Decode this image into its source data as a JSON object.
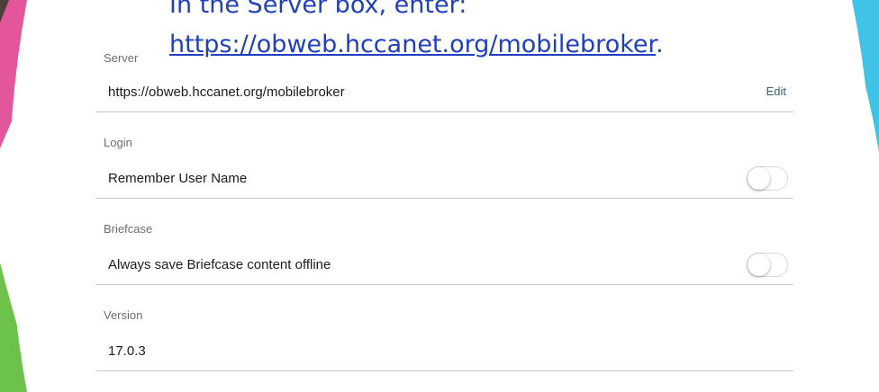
{
  "caption": {
    "line1": "In the Server box, enter:",
    "link": "https://obweb.hccanet.org/mobilebroker",
    "link_suffix": "."
  },
  "server": {
    "label": "Server",
    "value": "https://obweb.hccanet.org/mobilebroker",
    "edit_label": "Edit"
  },
  "login": {
    "label": "Login",
    "remember_label": "Remember User Name",
    "remember_on": false
  },
  "briefcase": {
    "label": "Briefcase",
    "offline_label": "Always save Briefcase content offline",
    "offline_on": false
  },
  "version": {
    "label": "Version",
    "value": "17.0.3"
  },
  "colors": {
    "caption_blue": "#1f3fbf",
    "accent_edit": "#3a5f73",
    "deco_pink": "#e4569a",
    "deco_dark": "#4a3f3a",
    "deco_green": "#6cc24a",
    "deco_cyan": "#3fc3e6"
  }
}
